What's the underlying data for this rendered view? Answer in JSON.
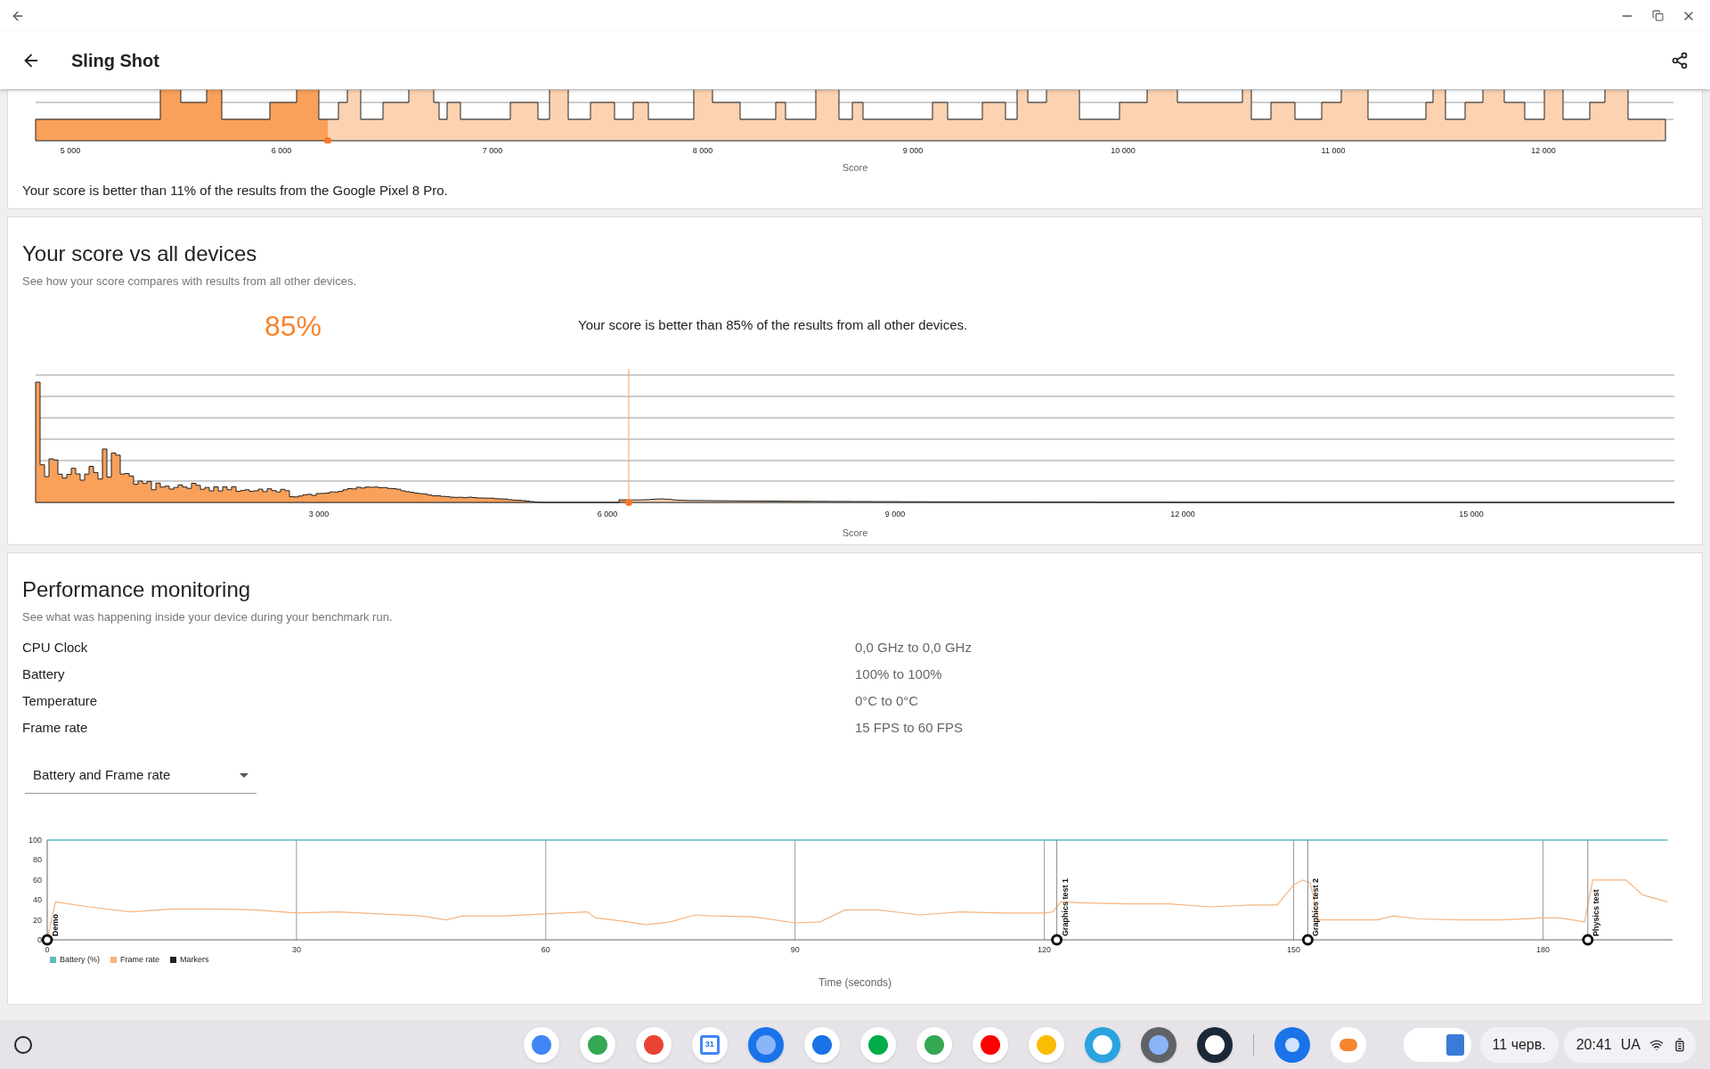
{
  "app_bar": {
    "title": "Sling Shot"
  },
  "device_distribution": {
    "x_ticks": [
      "5 000",
      "6 000",
      "7 000",
      "8 000",
      "9 000",
      "10 000",
      "11 000",
      "12 000"
    ],
    "axis_label": "Score",
    "summary": "Your score is better than 11% of the results from the Google Pixel 8 Pro."
  },
  "all_devices": {
    "title": "Your score vs all devices",
    "subtitle": "See how your score compares with results from all other devices.",
    "percentile": "85%",
    "summary": "Your score is better than 85% of the results from all other devices.",
    "x_ticks": [
      "3 000",
      "6 000",
      "9 000",
      "12 000",
      "15 000"
    ],
    "axis_label": "Score"
  },
  "performance": {
    "title": "Performance monitoring",
    "subtitle": "See what was happening inside your device during your benchmark run.",
    "metrics": [
      {
        "label": "CPU Clock",
        "value": "0,0 GHz to 0,0 GHz"
      },
      {
        "label": "Battery",
        "value": "100% to 100%"
      },
      {
        "label": "Temperature",
        "value": "0°C to 0°C"
      },
      {
        "label": "Frame rate",
        "value": "15 FPS to 60 FPS"
      }
    ],
    "dropdown": {
      "value": "Battery and Frame rate"
    },
    "chart_data": {
      "type": "line",
      "xlabel": "Time (seconds)",
      "xlim": [
        0,
        195.6
      ],
      "ylim": [
        0,
        100
      ],
      "xticks": [
        0,
        30,
        60,
        90,
        120,
        150,
        180
      ],
      "yticks": [
        0,
        20,
        40,
        60,
        80,
        100
      ],
      "x": [
        0,
        1,
        5,
        10,
        15,
        20,
        25,
        30,
        35,
        40,
        45,
        48,
        50,
        55,
        60,
        65,
        66,
        70,
        72,
        75,
        78,
        80,
        85,
        90,
        93,
        96,
        100,
        105,
        110,
        115,
        120,
        121,
        122,
        125,
        130,
        135,
        140,
        145,
        148,
        150,
        151,
        152,
        153,
        160,
        162,
        165,
        170,
        175,
        180,
        182,
        185,
        186,
        190,
        192,
        195
      ],
      "series": [
        {
          "name": "Battery (%)",
          "color": "#5cbcbc",
          "values": [
            100,
            100,
            100,
            100,
            100,
            100,
            100,
            100,
            100,
            100,
            100,
            100,
            100,
            100,
            100,
            100,
            100,
            100,
            100,
            100,
            100,
            100,
            100,
            100,
            100,
            100,
            100,
            100,
            100,
            100,
            100,
            100,
            100,
            100,
            100,
            100,
            100,
            100,
            100,
            100,
            100,
            100,
            100,
            100,
            100,
            100,
            100,
            100,
            100,
            100,
            100,
            100,
            100,
            100,
            100
          ]
        },
        {
          "name": "Frame rate",
          "color": "#f5b47f",
          "values": [
            0,
            38,
            33,
            28,
            31,
            31,
            30,
            27,
            28,
            26,
            24,
            20,
            24,
            24,
            26,
            28,
            22,
            18,
            15,
            18,
            25,
            24,
            23,
            17,
            18,
            30,
            30,
            25,
            28,
            27,
            27,
            28,
            38,
            37,
            36,
            36,
            33,
            35,
            35,
            55,
            60,
            57,
            20,
            20,
            24,
            21,
            20,
            20,
            22,
            22,
            18,
            60,
            60,
            45,
            38
          ]
        }
      ],
      "grid": true,
      "annotations": [
        {
          "x": 0,
          "y": 0,
          "text": "Demo"
        },
        {
          "x": 121.5,
          "y": 0,
          "text": "Graphics test 1"
        },
        {
          "x": 151.7,
          "y": 0,
          "text": "Graphics test 2"
        },
        {
          "x": 185.4,
          "y": 0,
          "text": "Physics test"
        }
      ]
    },
    "markers_legend": "Markers"
  },
  "taskbar": {
    "calendar_day": "31",
    "date": "11 черв.",
    "time": "20:41",
    "keyboard_layout": "UA"
  }
}
